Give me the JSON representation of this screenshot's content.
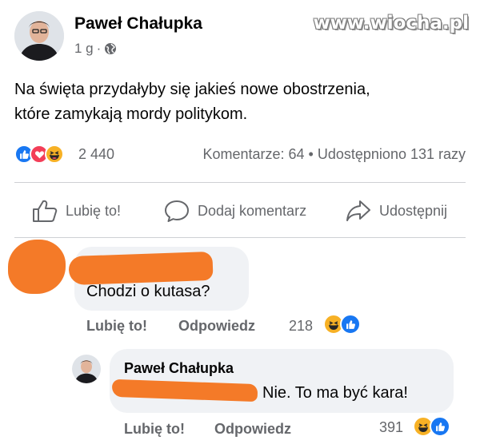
{
  "watermark": "www.wiocha.pl",
  "post": {
    "author": "Paweł Chałupka",
    "time": "1 g",
    "separator": "·",
    "text_line1": "Na święta przydałyby się jakieś nowe obostrzenia,",
    "text_line2": "które zamykają mordy politykom."
  },
  "stats": {
    "reaction_count": "2 440",
    "comments": "Komentarze: 64",
    "dot": "•",
    "shares": "Udostępniono 131 razy"
  },
  "actions": {
    "like": "Lubię to!",
    "comment": "Dodaj komentarz",
    "share": "Udostępnij"
  },
  "comments": [
    {
      "text": "Chodzi o kutasa?",
      "like_label": "Lubię to!",
      "reply_label": "Odpowiedz",
      "reaction_count": "218"
    },
    {
      "author": "Paweł Chałupka",
      "text": "Nie. To ma być kara!",
      "like_label": "Lubię to!",
      "reply_label": "Odpowiedz",
      "reaction_count": "391"
    }
  ],
  "colors": {
    "like_blue": "#1877f2",
    "love_red": "#f33e58",
    "haha_yellow": "#f7b125",
    "redaction_orange": "#f47a28",
    "muted_text": "#65676b"
  },
  "icons": [
    "globe-icon",
    "like-reaction-icon",
    "love-reaction-icon",
    "haha-reaction-icon",
    "thumbs-up-icon",
    "comment-icon",
    "share-icon"
  ]
}
